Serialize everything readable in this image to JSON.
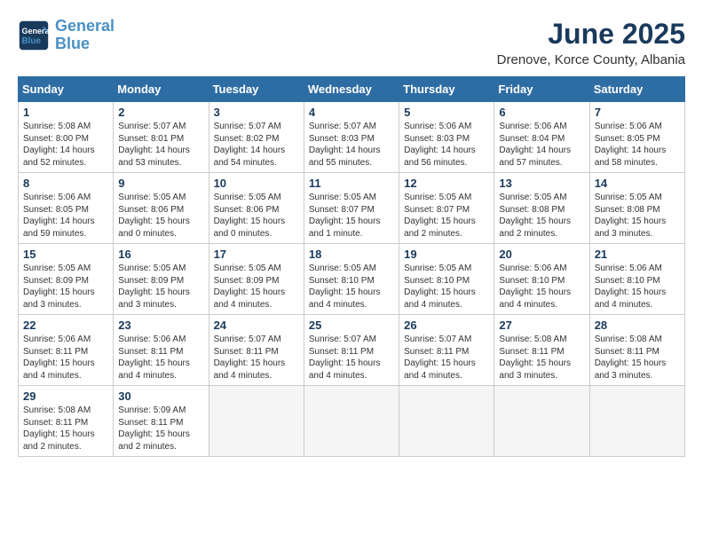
{
  "logo": {
    "line1": "General",
    "line2": "Blue"
  },
  "title": "June 2025",
  "subtitle": "Drenove, Korce County, Albania",
  "weekdays": [
    "Sunday",
    "Monday",
    "Tuesday",
    "Wednesday",
    "Thursday",
    "Friday",
    "Saturday"
  ],
  "weeks": [
    [
      {
        "day": "1",
        "info": "Sunrise: 5:08 AM\nSunset: 8:00 PM\nDaylight: 14 hours\nand 52 minutes."
      },
      {
        "day": "2",
        "info": "Sunrise: 5:07 AM\nSunset: 8:01 PM\nDaylight: 14 hours\nand 53 minutes."
      },
      {
        "day": "3",
        "info": "Sunrise: 5:07 AM\nSunset: 8:02 PM\nDaylight: 14 hours\nand 54 minutes."
      },
      {
        "day": "4",
        "info": "Sunrise: 5:07 AM\nSunset: 8:03 PM\nDaylight: 14 hours\nand 55 minutes."
      },
      {
        "day": "5",
        "info": "Sunrise: 5:06 AM\nSunset: 8:03 PM\nDaylight: 14 hours\nand 56 minutes."
      },
      {
        "day": "6",
        "info": "Sunrise: 5:06 AM\nSunset: 8:04 PM\nDaylight: 14 hours\nand 57 minutes."
      },
      {
        "day": "7",
        "info": "Sunrise: 5:06 AM\nSunset: 8:05 PM\nDaylight: 14 hours\nand 58 minutes."
      }
    ],
    [
      {
        "day": "8",
        "info": "Sunrise: 5:06 AM\nSunset: 8:05 PM\nDaylight: 14 hours\nand 59 minutes."
      },
      {
        "day": "9",
        "info": "Sunrise: 5:05 AM\nSunset: 8:06 PM\nDaylight: 15 hours\nand 0 minutes."
      },
      {
        "day": "10",
        "info": "Sunrise: 5:05 AM\nSunset: 8:06 PM\nDaylight: 15 hours\nand 0 minutes."
      },
      {
        "day": "11",
        "info": "Sunrise: 5:05 AM\nSunset: 8:07 PM\nDaylight: 15 hours\nand 1 minute."
      },
      {
        "day": "12",
        "info": "Sunrise: 5:05 AM\nSunset: 8:07 PM\nDaylight: 15 hours\nand 2 minutes."
      },
      {
        "day": "13",
        "info": "Sunrise: 5:05 AM\nSunset: 8:08 PM\nDaylight: 15 hours\nand 2 minutes."
      },
      {
        "day": "14",
        "info": "Sunrise: 5:05 AM\nSunset: 8:08 PM\nDaylight: 15 hours\nand 3 minutes."
      }
    ],
    [
      {
        "day": "15",
        "info": "Sunrise: 5:05 AM\nSunset: 8:09 PM\nDaylight: 15 hours\nand 3 minutes."
      },
      {
        "day": "16",
        "info": "Sunrise: 5:05 AM\nSunset: 8:09 PM\nDaylight: 15 hours\nand 3 minutes."
      },
      {
        "day": "17",
        "info": "Sunrise: 5:05 AM\nSunset: 8:09 PM\nDaylight: 15 hours\nand 4 minutes."
      },
      {
        "day": "18",
        "info": "Sunrise: 5:05 AM\nSunset: 8:10 PM\nDaylight: 15 hours\nand 4 minutes."
      },
      {
        "day": "19",
        "info": "Sunrise: 5:05 AM\nSunset: 8:10 PM\nDaylight: 15 hours\nand 4 minutes."
      },
      {
        "day": "20",
        "info": "Sunrise: 5:06 AM\nSunset: 8:10 PM\nDaylight: 15 hours\nand 4 minutes."
      },
      {
        "day": "21",
        "info": "Sunrise: 5:06 AM\nSunset: 8:10 PM\nDaylight: 15 hours\nand 4 minutes."
      }
    ],
    [
      {
        "day": "22",
        "info": "Sunrise: 5:06 AM\nSunset: 8:11 PM\nDaylight: 15 hours\nand 4 minutes."
      },
      {
        "day": "23",
        "info": "Sunrise: 5:06 AM\nSunset: 8:11 PM\nDaylight: 15 hours\nand 4 minutes."
      },
      {
        "day": "24",
        "info": "Sunrise: 5:07 AM\nSunset: 8:11 PM\nDaylight: 15 hours\nand 4 minutes."
      },
      {
        "day": "25",
        "info": "Sunrise: 5:07 AM\nSunset: 8:11 PM\nDaylight: 15 hours\nand 4 minutes."
      },
      {
        "day": "26",
        "info": "Sunrise: 5:07 AM\nSunset: 8:11 PM\nDaylight: 15 hours\nand 4 minutes."
      },
      {
        "day": "27",
        "info": "Sunrise: 5:08 AM\nSunset: 8:11 PM\nDaylight: 15 hours\nand 3 minutes."
      },
      {
        "day": "28",
        "info": "Sunrise: 5:08 AM\nSunset: 8:11 PM\nDaylight: 15 hours\nand 3 minutes."
      }
    ],
    [
      {
        "day": "29",
        "info": "Sunrise: 5:08 AM\nSunset: 8:11 PM\nDaylight: 15 hours\nand 2 minutes."
      },
      {
        "day": "30",
        "info": "Sunrise: 5:09 AM\nSunset: 8:11 PM\nDaylight: 15 hours\nand 2 minutes."
      },
      {
        "day": "",
        "info": ""
      },
      {
        "day": "",
        "info": ""
      },
      {
        "day": "",
        "info": ""
      },
      {
        "day": "",
        "info": ""
      },
      {
        "day": "",
        "info": ""
      }
    ]
  ]
}
